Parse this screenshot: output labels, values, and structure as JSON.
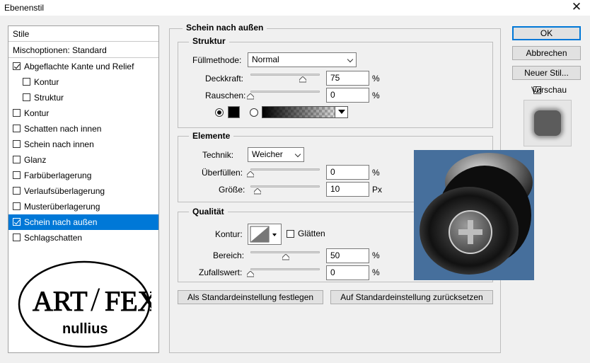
{
  "window": {
    "title": "Ebenenstil",
    "close_symbol": "✕"
  },
  "left_panel": {
    "header": "Stile",
    "blend_options": "Mischoptionen: Standard",
    "items": [
      {
        "label": "Abgeflachte Kante und Relief",
        "checked": true,
        "indent": false,
        "selected": false
      },
      {
        "label": "Kontur",
        "checked": false,
        "indent": true,
        "selected": false
      },
      {
        "label": "Struktur",
        "checked": false,
        "indent": true,
        "selected": false
      },
      {
        "label": "Kontur",
        "checked": false,
        "indent": false,
        "selected": false
      },
      {
        "label": "Schatten nach innen",
        "checked": false,
        "indent": false,
        "selected": false
      },
      {
        "label": "Schein nach innen",
        "checked": false,
        "indent": false,
        "selected": false
      },
      {
        "label": "Glanz",
        "checked": false,
        "indent": false,
        "selected": false
      },
      {
        "label": "Farbüberlagerung",
        "checked": false,
        "indent": false,
        "selected": false
      },
      {
        "label": "Verlaufsüberlagerung",
        "checked": false,
        "indent": false,
        "selected": false
      },
      {
        "label": "Musterüberlagerung",
        "checked": false,
        "indent": false,
        "selected": false
      },
      {
        "label": "Schein nach außen",
        "checked": true,
        "indent": false,
        "selected": true
      },
      {
        "label": "Schlagschatten",
        "checked": false,
        "indent": false,
        "selected": false
      }
    ],
    "logo": {
      "line1": "ART",
      "slash": "/",
      "line1b": "FEX",
      "line2": "nullius"
    }
  },
  "main": {
    "title": "Schein nach außen",
    "struktur": {
      "legend": "Struktur",
      "blend_mode_label": "Füllmethode:",
      "blend_mode_value": "Normal",
      "opacity_label": "Deckkraft:",
      "opacity_value": "75",
      "opacity_unit": "%",
      "opacity_fraction": 0.75,
      "noise_label": "Rauschen:",
      "noise_value": "0",
      "noise_unit": "%",
      "noise_fraction": 0.0
    },
    "elemente": {
      "legend": "Elemente",
      "technique_label": "Technik:",
      "technique_value": "Weicher",
      "spread_label": "Überfüllen:",
      "spread_value": "0",
      "spread_unit": "%",
      "size_label": "Größe:",
      "size_value": "10",
      "size_unit": "Px"
    },
    "qualitaet": {
      "legend": "Qualität",
      "contour_label": "Kontur:",
      "smooth_label": "Glätten",
      "range_label": "Bereich:",
      "range_value": "50",
      "range_unit": "%",
      "jitter_label": "Zufallswert:",
      "jitter_value": "0",
      "jitter_unit": "%"
    },
    "set_default": "Als Standardeinstellung festlegen",
    "reset_default": "Auf Standardeinstellung zurücksetzen"
  },
  "right": {
    "ok": "OK",
    "cancel": "Abbrechen",
    "new_style": "Neuer Stil...",
    "preview_label": "Vorschau",
    "preview_checked": true
  },
  "colors": {
    "accent": "#0078d7",
    "preview_bg": "#466f9c"
  }
}
